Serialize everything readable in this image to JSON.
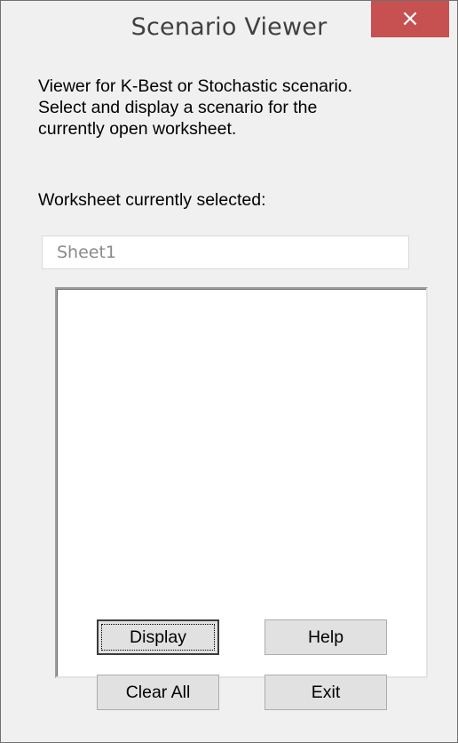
{
  "window": {
    "title": "Scenario Viewer",
    "close_glyph": "×"
  },
  "description": {
    "lines": [
      "Viewer for K-Best or Stochastic scenario.",
      "Select and display a scenario for the",
      "currently open worksheet."
    ]
  },
  "worksheet": {
    "label": "Worksheet currently selected:",
    "value": "Sheet1"
  },
  "scenario_list": {
    "items": []
  },
  "buttons": {
    "display": "Display",
    "help": "Help",
    "clear_all": "Clear All",
    "exit": "Exit"
  },
  "colors": {
    "close_button": "#c75050",
    "window_background": "#f0f0f0"
  }
}
